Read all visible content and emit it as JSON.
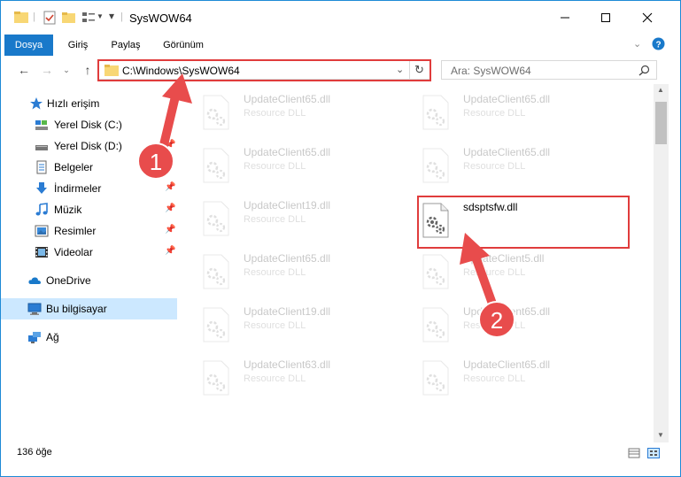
{
  "window": {
    "title": "SysWOW64"
  },
  "ribbon": {
    "tabs": [
      "Dosya",
      "Giriş",
      "Paylaş",
      "Görünüm"
    ]
  },
  "nav": {
    "address": "C:\\Windows\\SysWOW64",
    "search_placeholder": "Ara: SysWOW64"
  },
  "sidebar": {
    "items": [
      {
        "label": "Hızlı erişim",
        "icon": "star-icon"
      },
      {
        "label": "Yerel Disk (C:)",
        "icon": "drive-c-icon"
      },
      {
        "label": "Yerel Disk (D:)",
        "icon": "drive-d-icon"
      },
      {
        "label": "Belgeler",
        "icon": "documents-icon"
      },
      {
        "label": "İndirmeler",
        "icon": "download-icon"
      },
      {
        "label": "Müzik",
        "icon": "music-icon"
      },
      {
        "label": "Resimler",
        "icon": "pictures-icon"
      },
      {
        "label": "Videolar",
        "icon": "videos-icon"
      },
      {
        "label": "OneDrive",
        "icon": "cloud-icon"
      },
      {
        "label": "Bu bilgisayar",
        "icon": "computer-icon"
      },
      {
        "label": "Ağ",
        "icon": "network-icon"
      }
    ]
  },
  "files": {
    "left": [
      {
        "name": "UpdateClient65.dll",
        "type": "Resource DLL"
      },
      {
        "name": "UpdateClient65.dll",
        "type": "Resource DLL"
      },
      {
        "name": "UpdateClient19.dll",
        "type": "Resource DLL"
      },
      {
        "name": "UpdateClient65.dll",
        "type": "Resource DLL"
      },
      {
        "name": "UpdateClient19.dll",
        "type": "Resource DLL"
      },
      {
        "name": "UpdateClient63.dll",
        "type": "Resource DLL"
      }
    ],
    "right": [
      {
        "name": "UpdateClient65.dll",
        "type": "Resource DLL"
      },
      {
        "name": "UpdateClient65.dll",
        "type": "Resource DLL"
      },
      {
        "name": "sdsptsfw.dll",
        "type": ""
      },
      {
        "name": "UpdateClient5.dll",
        "type": "Resource DLL"
      },
      {
        "name": "UpdateClient65.dll",
        "type": "Resource DLL"
      },
      {
        "name": "UpdateClient65.dll",
        "type": "Resource DLL"
      }
    ]
  },
  "status": {
    "count": "136 öğe"
  },
  "annotations": {
    "step1": "1",
    "step2": "2"
  },
  "colors": {
    "accent": "#1979ca",
    "highlight": "#e03c3c",
    "selection": "#cce8ff"
  }
}
